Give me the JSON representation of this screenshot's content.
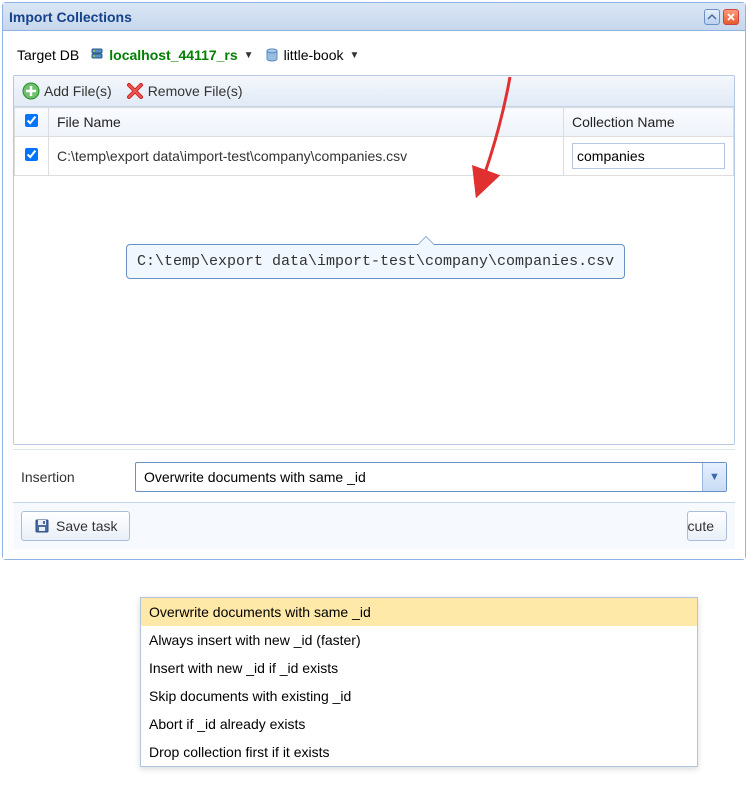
{
  "window": {
    "title": "Import Collections"
  },
  "target": {
    "label": "Target DB",
    "server": "localhost_44117_rs",
    "database": "little-book"
  },
  "toolbar": {
    "add_files": "Add File(s)",
    "remove_files": "Remove File(s)"
  },
  "table": {
    "headers": {
      "file_name": "File Name",
      "collection_name": "Collection Name"
    },
    "rows": [
      {
        "file": "C:\\temp\\export data\\import-test\\company\\companies.csv",
        "collection": "companies",
        "checked": true
      }
    ]
  },
  "tooltip": "C:\\temp\\export data\\import-test\\company\\companies.csv",
  "insertion": {
    "label": "Insertion",
    "selected": "Overwrite documents with same _id",
    "options": [
      "Overwrite documents with same _id",
      "Always insert with new _id (faster)",
      "Insert with new _id if _id exists",
      "Skip documents with existing _id",
      "Abort if _id already exists",
      "Drop collection first if it exists"
    ]
  },
  "buttons": {
    "save_task": "Save task",
    "execute": "cute"
  }
}
